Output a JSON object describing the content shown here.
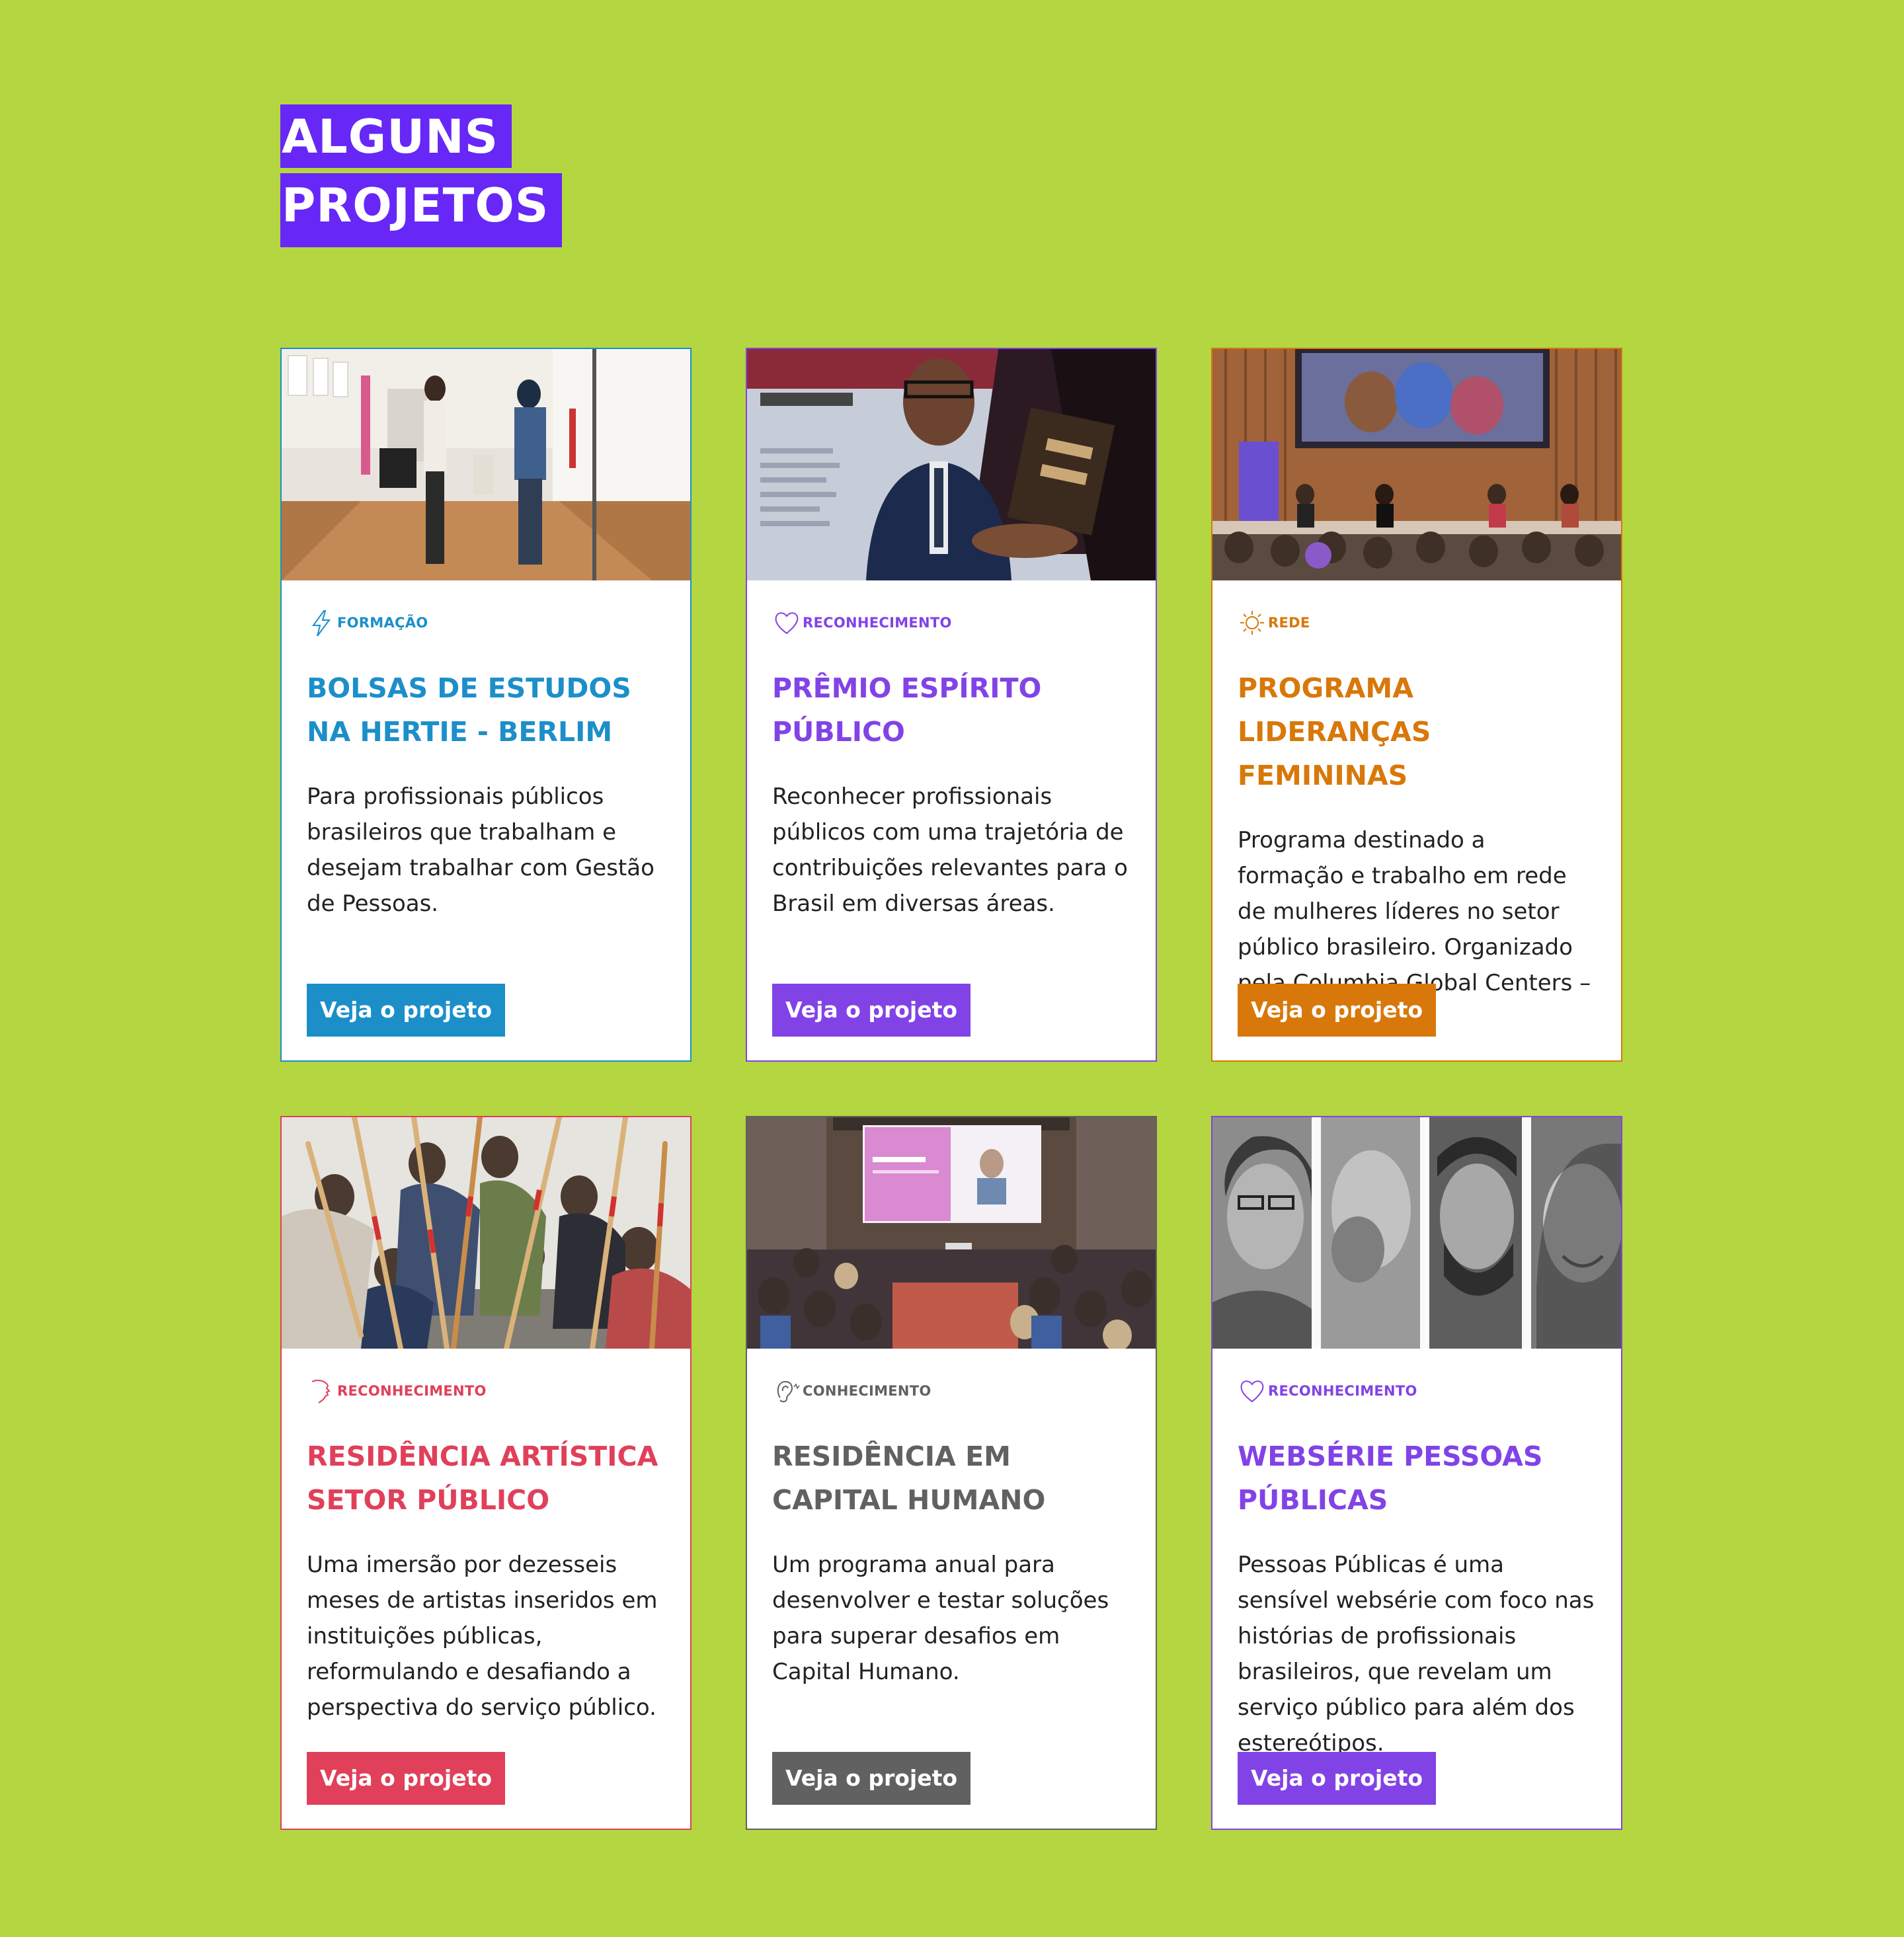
{
  "section": {
    "title_line1": "ALGUNS",
    "title_line2": "PROJETOS"
  },
  "colors": {
    "background": "#b4d641",
    "heading_bg": "#6627f7",
    "formacao": "#1c8fc9",
    "reconhecimento_purple": "#8243e6",
    "rede": "#d8780a",
    "reconhecimento_red": "#e0405a",
    "conhecimento": "#616161"
  },
  "cards": [
    {
      "category": "FORMAÇÃO",
      "category_icon": "lightning-icon",
      "title": "BOLSAS DE ESTUDOS NA HERTIE  - BERLIM",
      "description": "Para profissionais públicos brasileiros que trabalham e desejam trabalhar com Gestão de Pessoas.",
      "button": "Veja o projeto",
      "photo": "students-in-hallway-photo"
    },
    {
      "category": "RECONHECIMENTO",
      "category_icon": "heart-icon",
      "title": "PRÊMIO ESPÍRITO PÚBLICO",
      "description": "Reconhecer profissionais públicos com uma trajetória de contribuições relevantes para o Brasil em diversas áreas.",
      "button": "Veja o projeto",
      "photo": "man-holding-award-photo"
    },
    {
      "category": "REDE",
      "category_icon": "sun-icon",
      "title": "PROGRAMA LIDERANÇAS FEMININAS",
      "description": "Programa destinado a formação e trabalho em rede de mulheres líderes no setor público brasileiro. Organizado pela Columbia Global Centers – Rio.",
      "button": "Veja o projeto",
      "photo": "panel-on-stage-photo"
    },
    {
      "category": "RECONHECIMENTO",
      "category_icon": "face-profile-icon",
      "title": "RESIDÊNCIA ARTÍSTICA SETOR PÚBLICO",
      "description": "Uma imersão por dezesseis meses de artistas inseridos em instituições públicas, reformulando e desafiando a perspectiva do serviço público.",
      "button": "Veja o projeto",
      "photo": "group-with-poles-photo"
    },
    {
      "category": "CONHECIMENTO",
      "category_icon": "ear-icon",
      "title": "RESIDÊNCIA EM CAPITAL HUMANO",
      "description": "Um programa anual para desenvolver e testar soluções para superar desafios em Capital Humano.",
      "button": "Veja o projeto",
      "photo": "audience-watching-screen-photo"
    },
    {
      "category": "RECONHECIMENTO",
      "category_icon": "heart-icon",
      "title": "WEBSÉRIE PESSOAS PÚBLICAS",
      "description": "Pessoas Públicas é uma sensível websérie com foco nas histórias de profissionais brasileiros, que revelam um serviço público para além dos estereótipos.",
      "button": "Veja o projeto",
      "photo": "black-white-portraits-photo"
    }
  ]
}
